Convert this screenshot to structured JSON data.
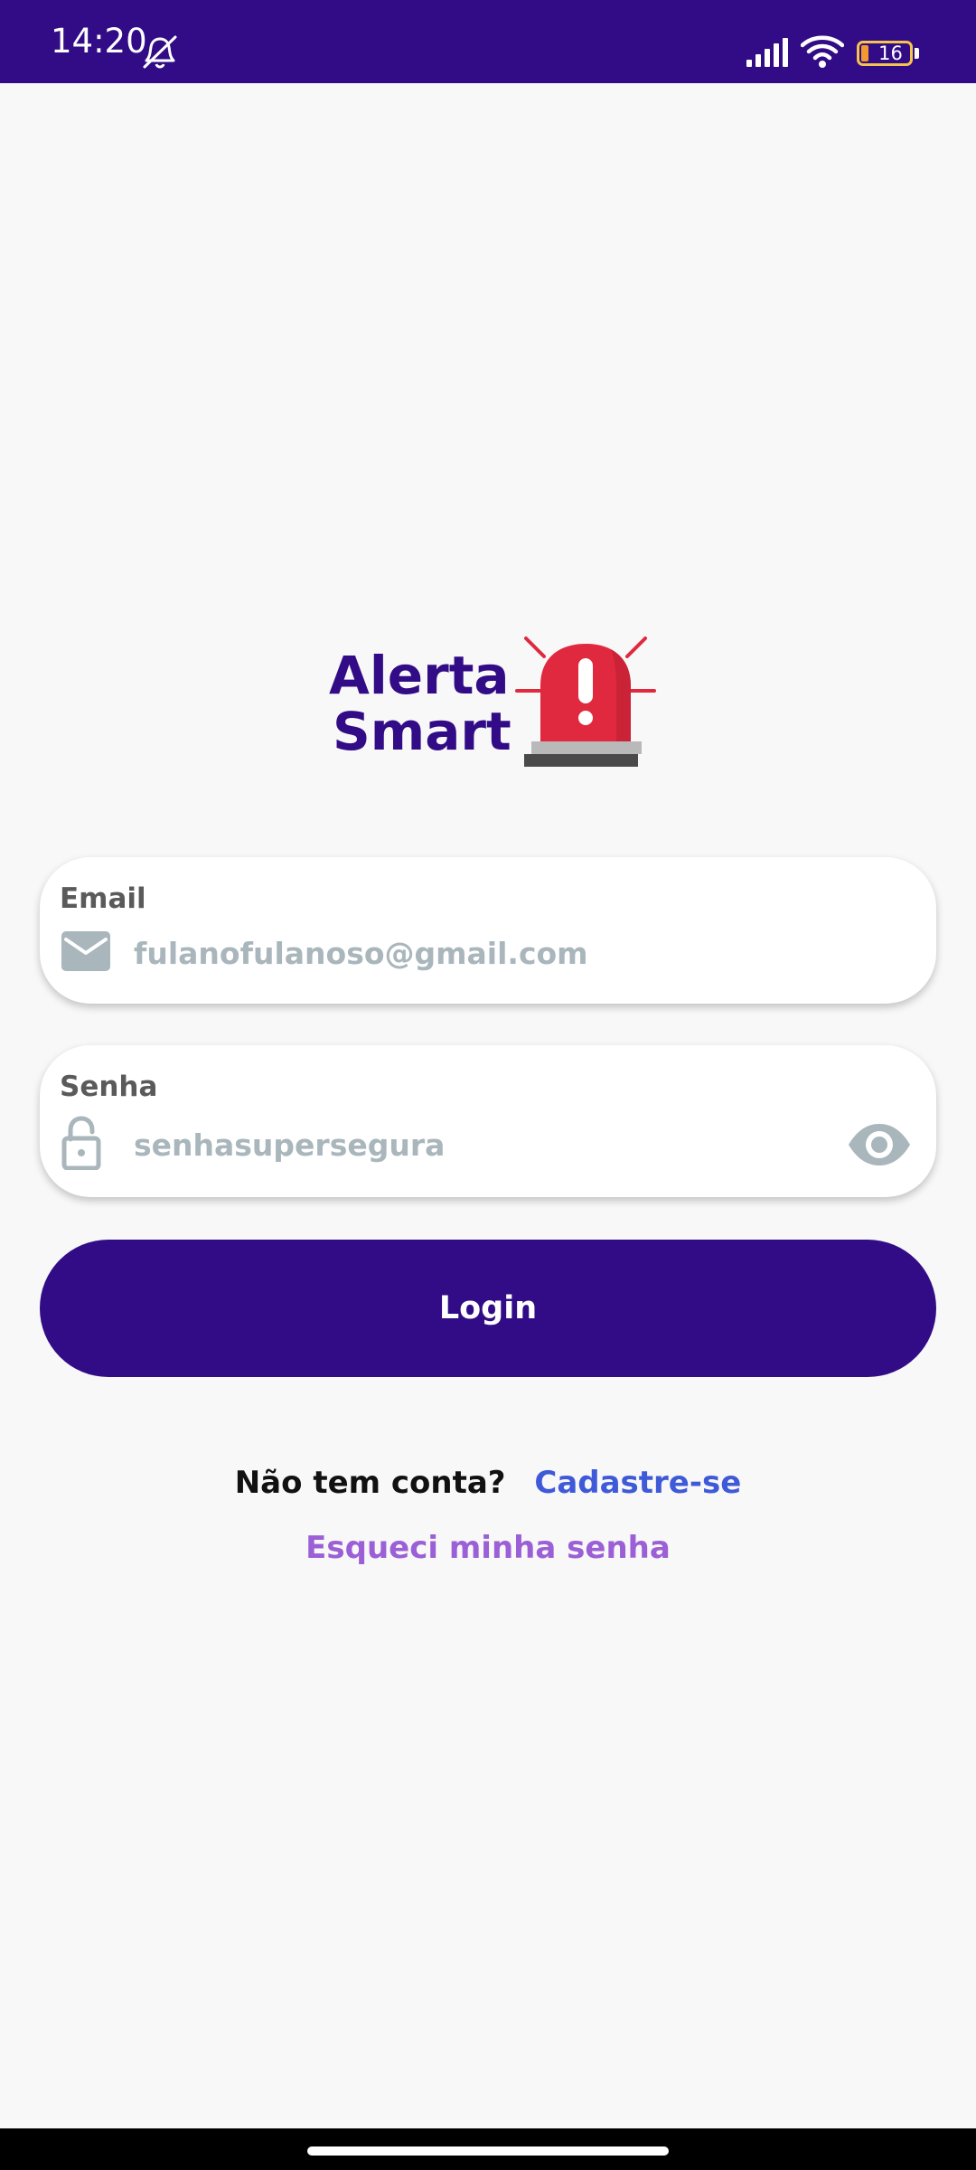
{
  "status_bar": {
    "time": "14:20",
    "battery_level": "16",
    "bg_color": "#320c86",
    "icons": [
      "bell-off-icon",
      "signal-icon",
      "wifi-icon",
      "battery-icon"
    ]
  },
  "logo": {
    "line1": "Alerta",
    "line2": "Smart",
    "icon": "siren-icon",
    "text_color": "#320c86",
    "siren_color": "#e0293f"
  },
  "email_field": {
    "label": "Email",
    "placeholder": "fulanofulanoso@gmail.com",
    "value": "",
    "icon": "envelope-icon"
  },
  "password_field": {
    "label": "Senha",
    "placeholder": "senhasupersegura",
    "value": "",
    "icon": "lock-icon",
    "toggle_icon": "eye-icon"
  },
  "login_button": {
    "label": "Login",
    "color": "#320c86"
  },
  "signup": {
    "question": "Não tem conta?",
    "link": "Cadastre-se",
    "link_color": "#3f5ad8"
  },
  "forgot_password": {
    "label": "Esqueci minha senha",
    "color": "#9b5fd6"
  }
}
